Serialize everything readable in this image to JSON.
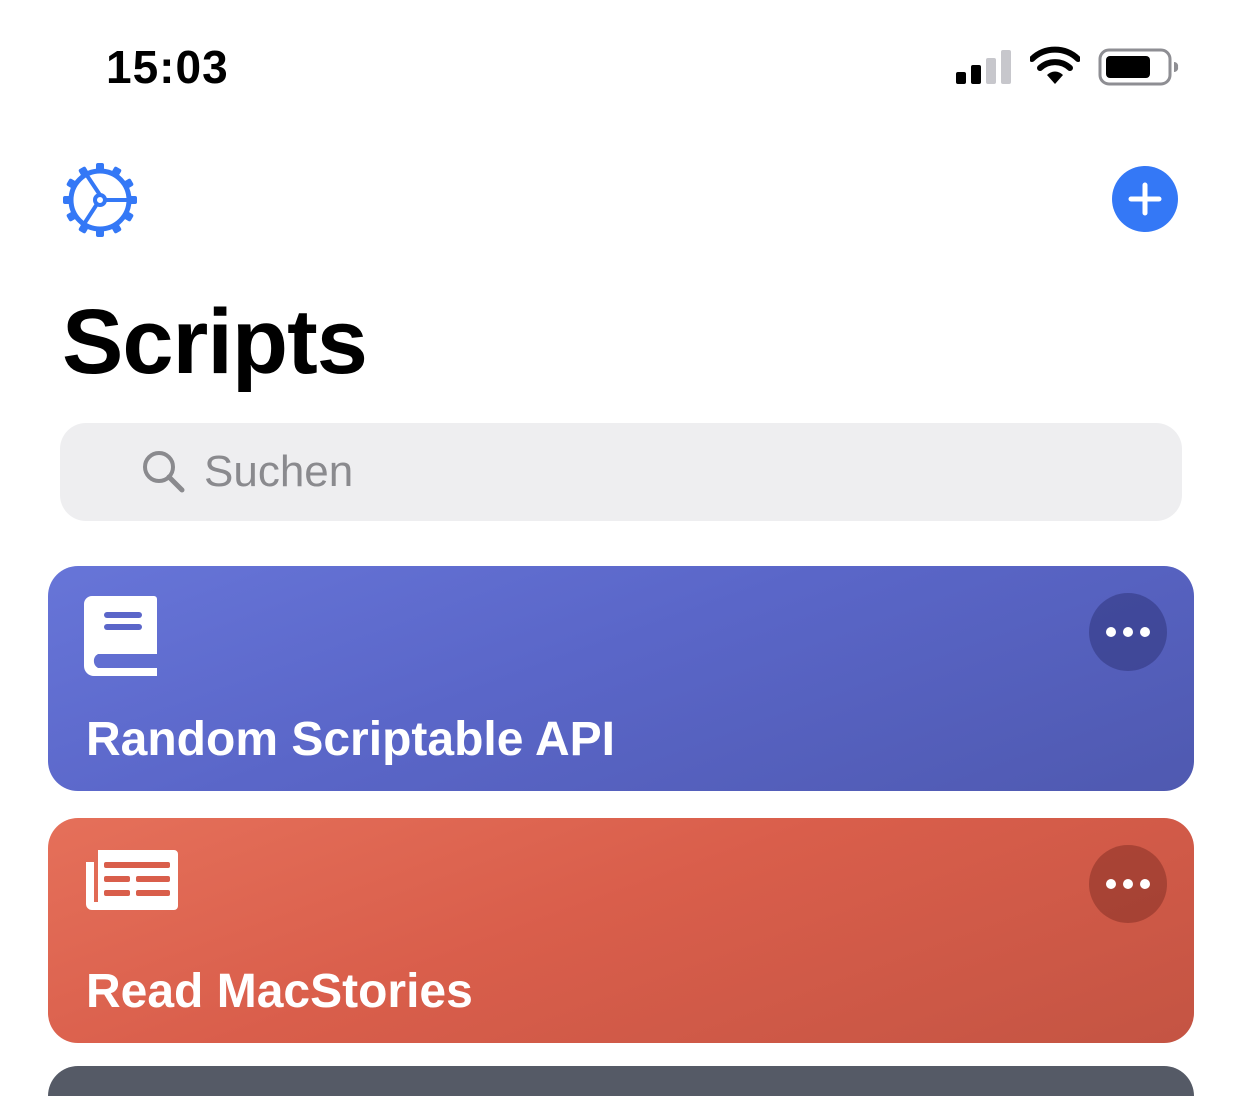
{
  "status_bar": {
    "time": "15:03",
    "signal_bars_active": 2,
    "signal_bars_total": 4,
    "battery_level": 0.75
  },
  "header": {
    "settings_icon": "gear-icon",
    "add_icon": "plus-icon",
    "accent_color": "#3478f6"
  },
  "page": {
    "title": "Scripts"
  },
  "search": {
    "placeholder": "Suchen",
    "value": ""
  },
  "scripts": [
    {
      "title": "Random Scriptable API",
      "icon": "book-icon",
      "color": "#5b66c9",
      "more_icon": "ellipsis-icon"
    },
    {
      "title": "Read MacStories",
      "icon": "newspaper-icon",
      "color": "#d95e4b",
      "more_icon": "ellipsis-icon"
    }
  ]
}
